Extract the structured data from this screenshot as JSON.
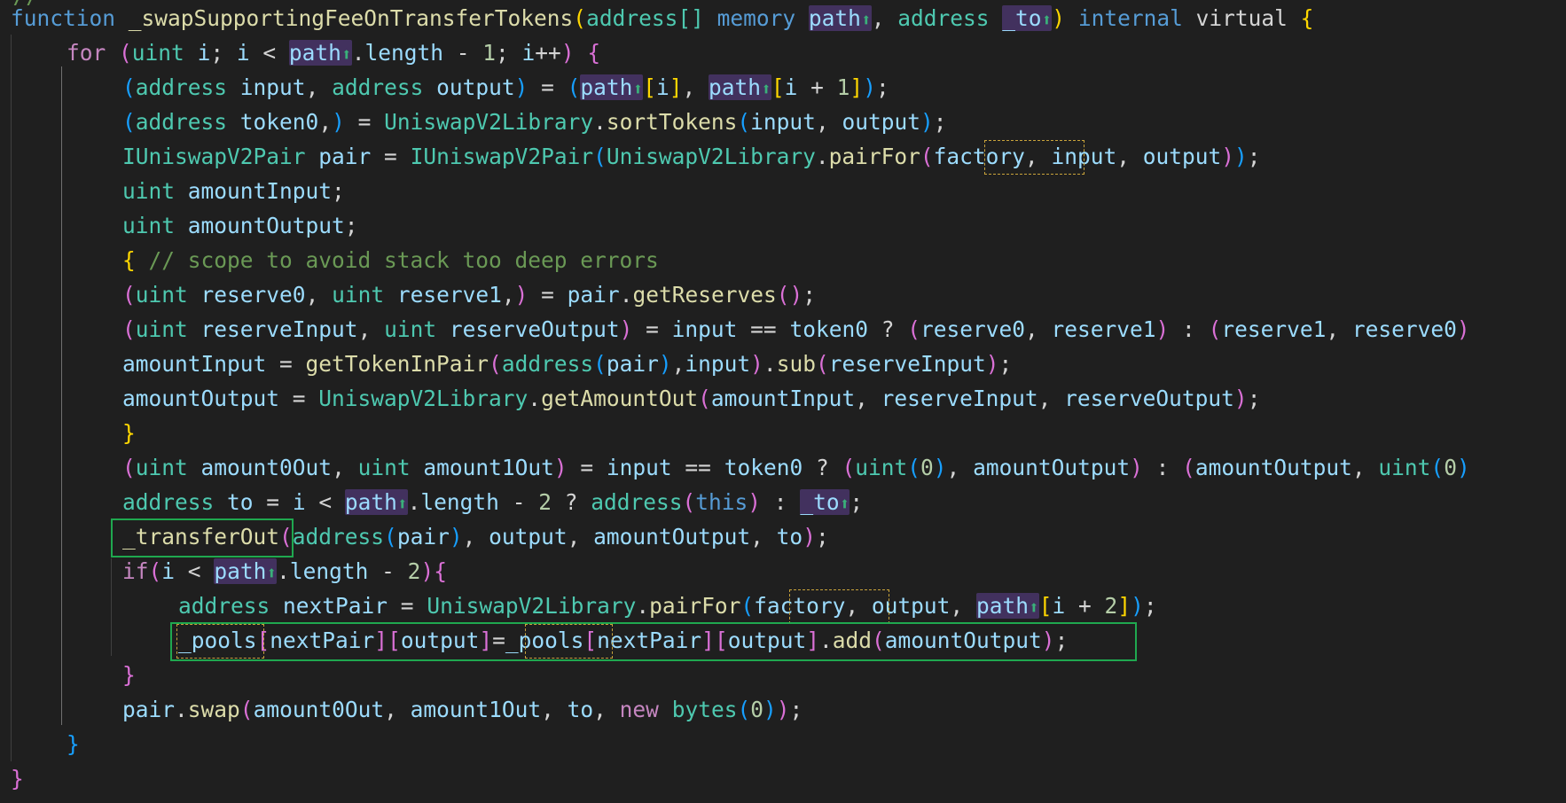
{
  "editor": {
    "function_keyword": "function",
    "function_name": "_swapSupportingFeeOnTransferTokens",
    "param_type_1": "address[]",
    "param_storage": "memory",
    "param_path": "path",
    "param_type_2": "address",
    "param_to": "_to",
    "visibility": "internal",
    "modifier": "virtual",
    "arrow_glyph": "⬆",
    "comment": "// scope to avoid stack too deep errors"
  },
  "highlights": {
    "transfer_out": "_transferOut",
    "pools_line": "_pools[nextPair][output]=_pools[nextPair][output].add(amountOutput);"
  },
  "colors": {
    "background": "#1f1f1f",
    "keyword": "#569cd6",
    "control": "#c586c0",
    "function": "#dcdcaa",
    "type": "#4ec9b0",
    "variable": "#9cdcfe",
    "number": "#b5cea8",
    "comment": "#6a9955",
    "highlight_box": "#1fa84f",
    "factory_dotted_box": "#c9a33b"
  }
}
